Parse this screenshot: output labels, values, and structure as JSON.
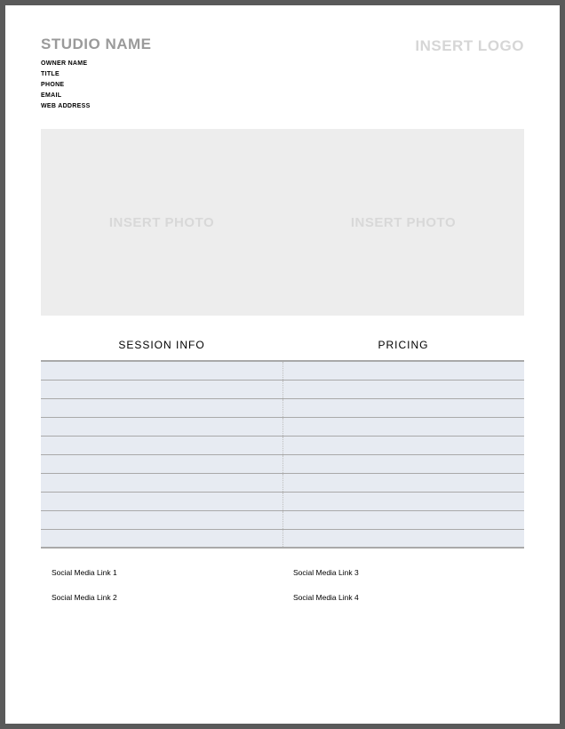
{
  "header": {
    "studio_name": "STUDIO NAME",
    "logo_placeholder": "INSERT LOGO",
    "contact": {
      "owner": "OWNER NAME",
      "title": "TITLE",
      "phone": "PHONE",
      "email": "EMAIL",
      "web": "WEB ADDRESS"
    }
  },
  "photos": {
    "left": "INSERT PHOTO",
    "right": "INSERT PHOTO"
  },
  "sections": {
    "left_title": "SESSION INFO",
    "right_title": "PRICING",
    "row_count": 10
  },
  "social": {
    "col1": [
      "Social Media Link 1",
      "Social Media Link 2"
    ],
    "col2": [
      "Social Media Link 3",
      "Social Media Link 4"
    ]
  }
}
